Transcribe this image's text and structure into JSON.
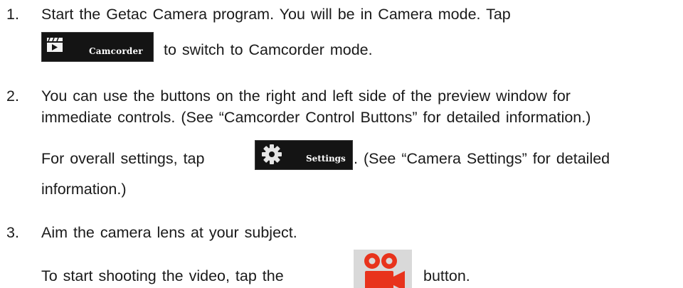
{
  "steps": [
    {
      "number": "1.",
      "line1": "Start the Getac Camera program. You will be in Camera mode. Tap",
      "line2": "to switch to Camcorder mode.",
      "button": {
        "label": "Camcorder",
        "icon": "clapperboard-icon",
        "background": "#141414"
      }
    },
    {
      "number": "2.",
      "line1": "You can use the buttons on the right and left side of the preview window for",
      "line2": "immediate controls. (See “Camcorder Control Buttons” for detailed information.)",
      "line3_before": "For overall settings, tap",
      "line3_after": ". (See “Camera Settings” for detailed",
      "line4": "information.)",
      "button": {
        "label": "Settings",
        "icon": "gear-icon",
        "background": "#141414"
      }
    },
    {
      "number": "3.",
      "line1": "Aim the camera lens at your subject.",
      "line2_before": "To start shooting the video, tap the",
      "line2_after": "button.",
      "button": {
        "icon": "record-video-icon",
        "color": "#e8331c",
        "background": "#d9d9d9"
      }
    }
  ]
}
